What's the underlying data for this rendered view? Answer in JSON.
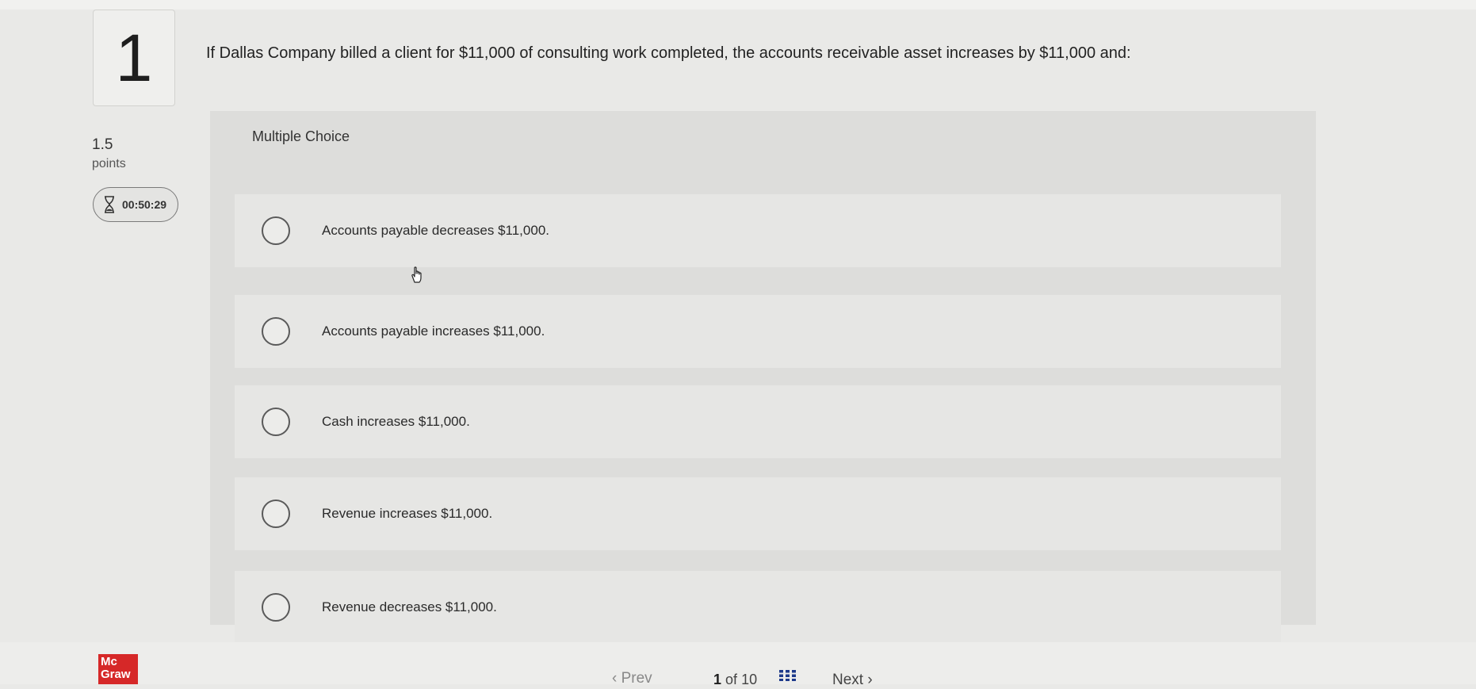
{
  "question": {
    "number": "1",
    "text": "If Dallas Company billed a client for $11,000 of consulting work completed, the accounts receivable asset increases by $11,000 and:"
  },
  "points": {
    "value": "1.5",
    "label": "points"
  },
  "timer": {
    "icon": "hourglass-icon",
    "value": "00:50:29"
  },
  "multiple_choice": {
    "title": "Multiple Choice",
    "options": [
      {
        "label": "Accounts payable decreases $11,000."
      },
      {
        "label": "Accounts payable increases $11,000."
      },
      {
        "label": "Cash increases $11,000."
      },
      {
        "label": "Revenue increases $11,000."
      },
      {
        "label": "Revenue decreases $11,000."
      }
    ]
  },
  "footer": {
    "logo_line1": "Mc",
    "logo_line2": "Graw",
    "prev_label": "Prev",
    "current_page": "1",
    "of_label": "of",
    "total_pages": "10",
    "next_label": "Next"
  },
  "colors": {
    "brand_red": "#d62828"
  }
}
